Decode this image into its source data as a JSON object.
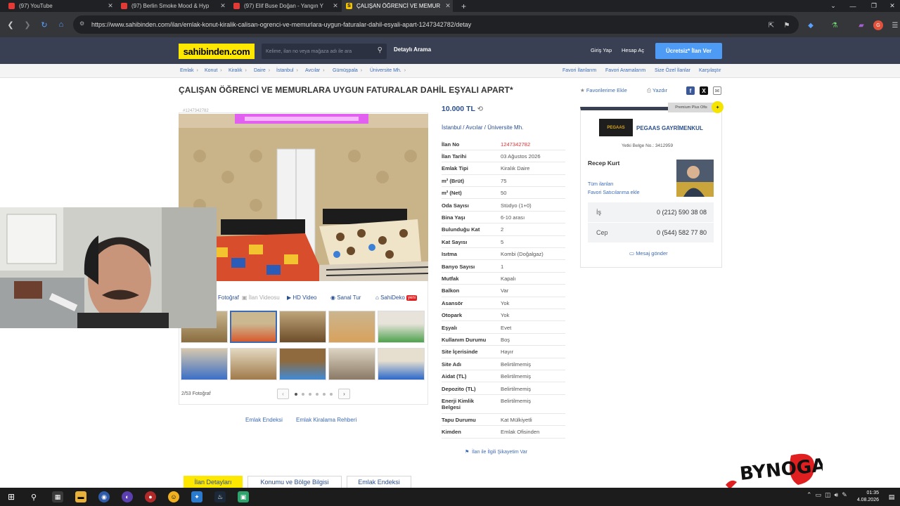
{
  "browser": {
    "tabs": [
      {
        "title": "(97) YouTube",
        "icon": "youtube-icon"
      },
      {
        "title": "(97) Berlin Smoke Mood & Hyp",
        "icon": "youtube-icon"
      },
      {
        "title": "(97) Elif Buse Doğan - Yangın Y",
        "icon": "youtube-icon"
      },
      {
        "title": "ÇALIŞAN ÖĞRENCİ VE MEMUR",
        "icon": "sahibinden-icon",
        "favicon_letter": "S",
        "active": true
      }
    ],
    "url": "https://www.sahibinden.com/ilan/emlak-konut-kiralik-calisan-ogrenci-ve-memurlara-uygun-faturalar-dahil-esyali-apart-1247342782/detay"
  },
  "header": {
    "logo": "sahibinden.com",
    "search_placeholder": "Kelime, ilan no veya mağaza adı ile ara",
    "detailed_search": "Detaylı Arama",
    "login": "Giriş Yap",
    "register": "Hesap Aç",
    "post_button": "Ücretsiz* İlan Ver"
  },
  "breadcrumb": [
    "Emlak",
    "Konut",
    "Kiralık",
    "Daire",
    "İstanbul",
    "Avcılar",
    "Gümüşpala",
    "Üniversite Mh."
  ],
  "breadcrumb_right": [
    "Favori İlanlarım",
    "Favori Aramalarım",
    "Size Özel İlanlar",
    "Karşılaştır"
  ],
  "listing": {
    "title": "ÇALIŞAN ÖĞRENCİ VE MEMURLARA UYGUN FATURALAR DAHİL EŞYALI APART*",
    "add_favorite": "Favorilerime Ekle",
    "print": "Yazdır",
    "id_label": "#1247342782",
    "price": "10.000 TL",
    "location": [
      "İstanbul",
      "Avcılar",
      "Üniversite Mh."
    ],
    "details": [
      {
        "k": "İlan No",
        "v": "1247342782",
        "red": true
      },
      {
        "k": "İlan Tarihi",
        "v": "03 Ağustos 2026"
      },
      {
        "k": "Emlak Tipi",
        "v": "Kiralık Daire"
      },
      {
        "k": "m² (Brüt)",
        "v": "75"
      },
      {
        "k": "m² (Net)",
        "v": "50"
      },
      {
        "k": "Oda Sayısı",
        "v": "Stüdyo (1+0)"
      },
      {
        "k": "Bina Yaşı",
        "v": "6-10 arası"
      },
      {
        "k": "Bulunduğu Kat",
        "v": "2"
      },
      {
        "k": "Kat Sayısı",
        "v": "5"
      },
      {
        "k": "Isıtma",
        "v": "Kombi (Doğalgaz)"
      },
      {
        "k": "Banyo Sayısı",
        "v": "1"
      },
      {
        "k": "Mutfak",
        "v": "Kapalı"
      },
      {
        "k": "Balkon",
        "v": "Var"
      },
      {
        "k": "Asansör",
        "v": "Yok"
      },
      {
        "k": "Otopark",
        "v": "Yok"
      },
      {
        "k": "Eşyalı",
        "v": "Evet"
      },
      {
        "k": "Kullanım Durumu",
        "v": "Boş"
      },
      {
        "k": "Site İçerisinde",
        "v": "Hayır"
      },
      {
        "k": "Site Adı",
        "v": "Belirtilmemiş"
      },
      {
        "k": "Aidat (TL)",
        "v": "Belirtilmemiş"
      },
      {
        "k": "Depozito (TL)",
        "v": "Belirtilmemiş"
      },
      {
        "k": "Enerji Kimlik Belgesi",
        "v": "Belirtilmemiş"
      },
      {
        "k": "Tapu Durumu",
        "v": "Kat Mülkiyetli"
      },
      {
        "k": "Kimden",
        "v": "Emlak Ofisinden"
      }
    ],
    "complaint": "İlan ile İlgili Şikayetim Var"
  },
  "gallery": {
    "media_tabs": [
      "Fotoğraf",
      "İlan Videosu",
      "HD Video",
      "Sanal Tur",
      "SahiDeko"
    ],
    "new_badge": "yeni",
    "photo_count": "2/53 Fotoğraf",
    "pages": 6,
    "current_page": 1,
    "links": [
      "Emlak Endeksi",
      "Emlak Kiralama Rehberi"
    ]
  },
  "seller": {
    "badge": "Premium Plus Ofis",
    "firm": "PEGAAS GAYRİMENKUL",
    "firm_logo": "PEGAAS",
    "license": "Yetki Belge No.: 3412959",
    "name": "Recep Kurt",
    "all_listings": "Tüm ilanları",
    "fav_seller": "Favori Satıcılarıma ekle",
    "phones": [
      {
        "k": "İş",
        "v": "0 (212) 590 38 08"
      },
      {
        "k": "Cep",
        "v": "0 (544) 582 77 80"
      }
    ],
    "message": "Mesaj gönder"
  },
  "bottom_tabs": [
    "İlan Detayları",
    "Konumu ve Bölge Bilgisi",
    "Emlak Endeksi"
  ],
  "taskbar": {
    "time": "01:35",
    "date": "4.08.2026"
  },
  "overlay_logo": "BYNOGA"
}
